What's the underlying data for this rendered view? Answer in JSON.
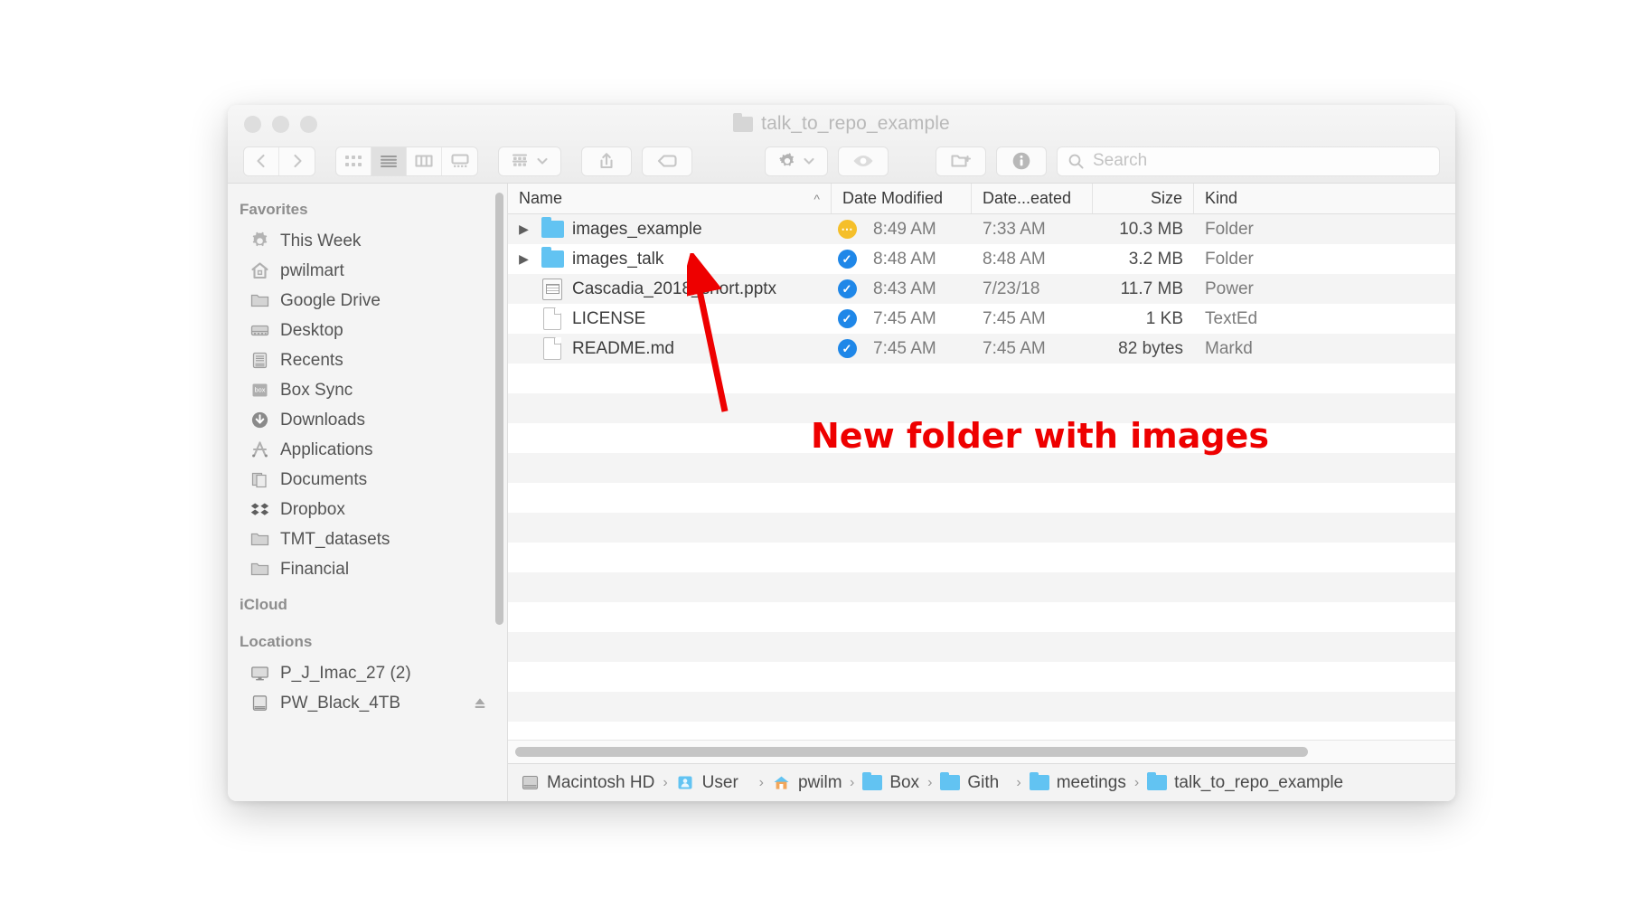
{
  "window": {
    "title": "talk_to_repo_example",
    "title_icon": "folder-icon",
    "traffic_lights": [
      "close-button",
      "minimize-button",
      "zoom-button"
    ]
  },
  "toolbar": {
    "back_icon": "chevron-left-icon",
    "forward_icon": "chevron-right-icon",
    "view_icon_grid": "icon-view-icon",
    "view_list": "list-view-icon",
    "view_column": "column-view-icon",
    "view_gallery": "gallery-view-icon",
    "arrange_icon": "arrange-group-icon",
    "arrange_chevron": "chevron-down-icon",
    "share_icon": "share-icon",
    "tags_icon": "tag-icon",
    "action_icon": "gear-icon",
    "action_chevron": "chevron-down-icon",
    "quicklook_icon": "eye-icon",
    "newfolder_icon": "new-folder-icon",
    "info_icon": "info-icon",
    "selected_view": "list"
  },
  "search": {
    "placeholder": "Search",
    "value": "",
    "icon": "search-icon"
  },
  "sidebar": {
    "sections": [
      {
        "header": "Favorites",
        "items": [
          {
            "label": "This Week",
            "icon": "gear-icon"
          },
          {
            "label": "pwilmart",
            "icon": "home-icon"
          },
          {
            "label": "Google Drive",
            "icon": "folder-icon"
          },
          {
            "label": "Desktop",
            "icon": "desktop-icon"
          },
          {
            "label": "Recents",
            "icon": "recents-icon"
          },
          {
            "label": "Box Sync",
            "icon": "box-icon"
          },
          {
            "label": "Downloads",
            "icon": "download-icon"
          },
          {
            "label": "Applications",
            "icon": "applications-icon"
          },
          {
            "label": "Documents",
            "icon": "documents-icon"
          },
          {
            "label": "Dropbox",
            "icon": "dropbox-icon"
          },
          {
            "label": "TMT_datasets",
            "icon": "folder-icon"
          },
          {
            "label": "Financial",
            "icon": "folder-icon"
          }
        ]
      },
      {
        "header": "iCloud",
        "items": []
      },
      {
        "header": "Locations",
        "items": [
          {
            "label": "P_J_Imac_27 (2)",
            "icon": "display-icon"
          },
          {
            "label": "PW_Black_4TB",
            "icon": "external-drive-icon",
            "eject": "eject-icon"
          }
        ]
      }
    ]
  },
  "filelist": {
    "columns": [
      {
        "key": "name",
        "label": "Name",
        "sorted": "ascending",
        "sort_icon": "chevron-up-icon"
      },
      {
        "key": "modified",
        "label": "Date Modified"
      },
      {
        "key": "created",
        "label": "Date...eated"
      },
      {
        "key": "size",
        "label": "Size"
      },
      {
        "key": "kind",
        "label": "Kind"
      }
    ],
    "rows": [
      {
        "name": "images_example",
        "icon": "folder-icon",
        "disclosure": "disclosure-triangle-right",
        "status": "syncing",
        "status_icon": "sync-pending-badge",
        "modified": "8:49 AM",
        "created": "7:33 AM",
        "size": "10.3 MB",
        "kind": "Folder"
      },
      {
        "name": "images_talk",
        "icon": "folder-icon",
        "disclosure": "disclosure-triangle-right",
        "status": "synced",
        "status_icon": "synced-check-badge",
        "modified": "8:48 AM",
        "created": "8:48 AM",
        "size": "3.2 MB",
        "kind": "Folder"
      },
      {
        "name": "Cascadia_2018_short.pptx",
        "icon": "powerpoint-document-icon",
        "disclosure": "",
        "status": "synced",
        "status_icon": "synced-check-badge",
        "modified": "8:43 AM",
        "created": "7/23/18",
        "size": "11.7 MB",
        "kind": "Power"
      },
      {
        "name": "LICENSE",
        "icon": "plain-document-icon",
        "disclosure": "",
        "status": "synced",
        "status_icon": "synced-check-badge",
        "modified": "7:45 AM",
        "created": "7:45 AM",
        "size": "1 KB",
        "kind": "TextEd"
      },
      {
        "name": "README.md",
        "icon": "plain-document-icon",
        "disclosure": "",
        "status": "synced",
        "status_icon": "synced-check-badge",
        "modified": "7:45 AM",
        "created": "7:45 AM",
        "size": "82 bytes",
        "kind": "Markd"
      }
    ],
    "empty_row_count": 14
  },
  "pathbar": {
    "crumbs": [
      {
        "label": "Macintosh HD",
        "icon": "hard-drive-icon"
      },
      {
        "label": "User",
        "icon": "users-folder-icon"
      },
      {
        "label": "pwilm",
        "icon": "home-icon"
      },
      {
        "label": "Box",
        "icon": "folder-icon"
      },
      {
        "label": "Gith",
        "icon": "folder-icon"
      },
      {
        "label": "meetings",
        "icon": "folder-icon"
      },
      {
        "label": "talk_to_repo_example",
        "icon": "folder-icon"
      }
    ],
    "separator": "›"
  },
  "annotation": {
    "text": "New folder with images",
    "color": "#ee0000",
    "arrow": "red-arrow-pointing-to-images-talk"
  },
  "colors": {
    "folder_blue": "#62c3f2",
    "status_synced": "#1f87e8",
    "status_syncing": "#f5bf2a",
    "annotation_red": "#ee0000",
    "sidebar_bg": "#f4f4f4",
    "row_stripe": "#f4f4f4"
  }
}
